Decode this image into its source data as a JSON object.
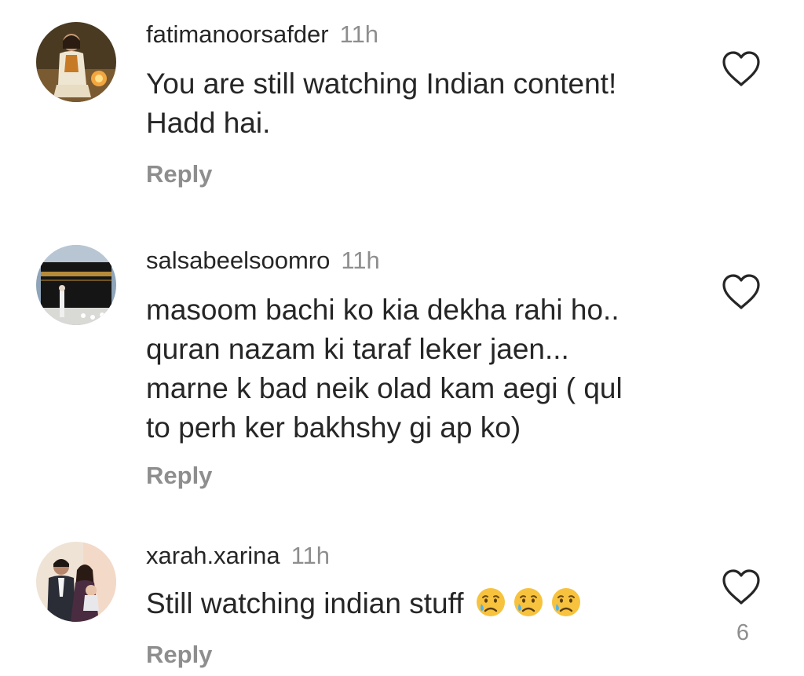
{
  "comments": [
    {
      "username": "fatimanoorsafder",
      "time": "11h",
      "lines": [
        "You are still watching Indian content!",
        "Hadd hai."
      ],
      "reply_label": "Reply",
      "like_count": "",
      "avatar_icon": "avatar-woman-outdoors"
    },
    {
      "username": "salsabeelsoomro",
      "time": "11h",
      "lines": [
        "masoom bachi ko kia dekha rahi ho..",
        "quran nazam ki taraf leker jaen...",
        "marne k bad neik olad kam aegi ( qul",
        "to perh ker bakhshy gi ap ko)"
      ],
      "reply_label": "Reply",
      "like_count": "",
      "avatar_icon": "avatar-kaaba"
    },
    {
      "username": "xarah.xarina",
      "time": "11h",
      "lines": [
        "Still watching indian stuff"
      ],
      "emojis": [
        "crying-face",
        "crying-face",
        "crying-face"
      ],
      "reply_label": "Reply",
      "like_count": "6",
      "avatar_icon": "avatar-family-photo"
    }
  ],
  "colors": {
    "text_primary": "#262626",
    "text_secondary": "#8e8e8e",
    "background": "#ffffff",
    "emoji_face": "#f7c23d",
    "emoji_tear": "#4fb3f0"
  }
}
